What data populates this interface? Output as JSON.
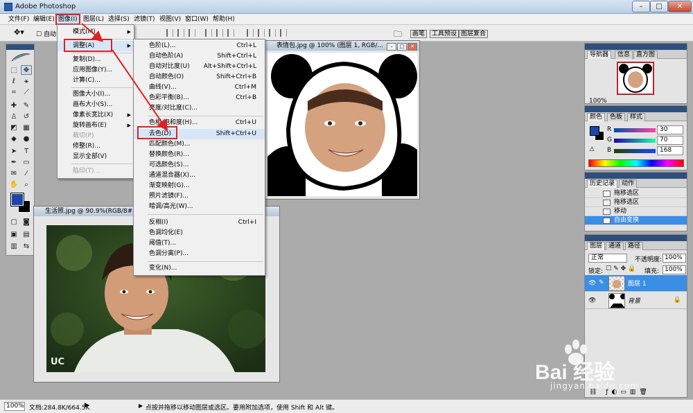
{
  "titlebar": {
    "title": "Adobe Photoshop",
    "minimize": "–",
    "maximize": "□",
    "close": "✕"
  },
  "menubar": {
    "items": [
      "文件(F)",
      "编辑(E)",
      "图像(I)",
      "图层(L)",
      "选择(S)",
      "滤镜(T)",
      "视图(V)",
      "窗口(W)",
      "帮助(H)"
    ]
  },
  "options": {
    "autoselect": "自动",
    "palette_tabs": [
      "画笔",
      "工具预设",
      "图层复合"
    ]
  },
  "image_menu": {
    "items": [
      {
        "label": "模式(M)"
      },
      {
        "label": "调整(A)"
      },
      {
        "label": "复制(D)..."
      },
      {
        "label": "应用图像(Y)..."
      },
      {
        "label": "计算(C)..."
      },
      {
        "label": "图像大小(I)..."
      },
      {
        "label": "画布大小(S)..."
      },
      {
        "label": "像素长宽比(X)"
      },
      {
        "label": "旋转画布(E)"
      },
      {
        "label": "裁切(P)"
      },
      {
        "label": "修整(R)..."
      },
      {
        "label": "显示全部(V)"
      },
      {
        "label": "陷印(T)..."
      }
    ]
  },
  "adjust_menu": {
    "items": [
      {
        "label": "色阶(L)...",
        "shortcut": "Ctrl+L"
      },
      {
        "label": "自动色阶(A)",
        "shortcut": "Shift+Ctrl+L"
      },
      {
        "label": "自动对比度(U)",
        "shortcut": "Alt+Shift+Ctrl+L"
      },
      {
        "label": "自动颜色(O)",
        "shortcut": "Shift+Ctrl+B"
      },
      {
        "label": "曲线(V)...",
        "shortcut": "Ctrl+M"
      },
      {
        "label": "色彩平衡(B)...",
        "shortcut": "Ctrl+B"
      },
      {
        "label": "亮度/对比度(C)...",
        "shortcut": ""
      },
      {
        "label": "色相/饱和度(H)...",
        "shortcut": "Ctrl+U"
      },
      {
        "label": "去色(D)",
        "shortcut": "Shift+Ctrl+U"
      },
      {
        "label": "匹配颜色(M)...",
        "shortcut": ""
      },
      {
        "label": "替换颜色(R)...",
        "shortcut": ""
      },
      {
        "label": "可选颜色(S)...",
        "shortcut": ""
      },
      {
        "label": "通道混合器(X)...",
        "shortcut": ""
      },
      {
        "label": "渐变映射(G)...",
        "shortcut": ""
      },
      {
        "label": "照片滤镜(F)...",
        "shortcut": ""
      },
      {
        "label": "暗调/高光(W)...",
        "shortcut": ""
      },
      {
        "label": "反相(I)",
        "shortcut": "Ctrl+I"
      },
      {
        "label": "色调均化(E)",
        "shortcut": ""
      },
      {
        "label": "阈值(T)...",
        "shortcut": ""
      },
      {
        "label": "色调分离(P)...",
        "shortcut": ""
      },
      {
        "label": "变化(N)...",
        "shortcut": ""
      }
    ]
  },
  "doc_meme": {
    "title": "表情包.jpg @ 100% (图层 1, RGB/..."
  },
  "doc_photo": {
    "title": "生活照.jpg @ 90.9%(RGB/8#)",
    "corner_text": "UC"
  },
  "navigator": {
    "tabs": [
      "导航器",
      "信息",
      "直方图"
    ],
    "zoom": "100%"
  },
  "color_panel": {
    "tabs": [
      "颜色",
      "色板",
      "样式"
    ],
    "channels": [
      {
        "name": "R",
        "value": "30"
      },
      {
        "name": "G",
        "value": "70"
      },
      {
        "name": "B",
        "value": "168"
      }
    ],
    "fg_color": "#1e46a8"
  },
  "history_panel": {
    "tabs": [
      "历史记录",
      "动作"
    ],
    "items": [
      "拖移选区",
      "拖移选区",
      "移动",
      "自由变换"
    ]
  },
  "layers_panel": {
    "tabs": [
      "图层",
      "通道",
      "路径"
    ],
    "blend_mode": "正常",
    "opacity_label": "不透明度:",
    "opacity": "100%",
    "lock_label": "锁定:",
    "fill_label": "填充:",
    "fill": "100%",
    "layers": [
      {
        "name": "图层 1"
      },
      {
        "name": "背景"
      }
    ]
  },
  "statusbar": {
    "zoom": "100%",
    "doc_info": "文档:284.8K/664.5K",
    "hint": "点按并拖移以移动图层或选区。要用附加选项，使用 Shift 和 Alt 键。"
  },
  "watermark": {
    "brand": "Bai  经验",
    "url": "jingyan.baidu.com"
  }
}
